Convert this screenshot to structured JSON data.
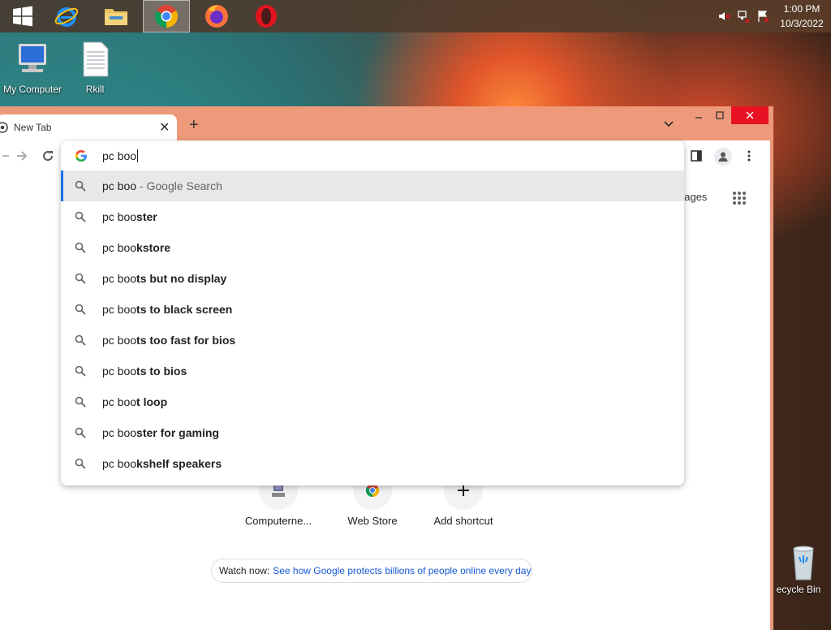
{
  "taskbar": {
    "apps": [
      {
        "name": "windows-start",
        "label": "Start"
      },
      {
        "name": "internet-explorer",
        "label": "Internet Explorer"
      },
      {
        "name": "file-explorer",
        "label": "File Explorer"
      },
      {
        "name": "chrome",
        "label": "Google Chrome"
      },
      {
        "name": "firefox",
        "label": "Firefox"
      },
      {
        "name": "opera",
        "label": "Opera"
      }
    ],
    "clock": {
      "time": "1:00 PM",
      "date": "10/3/2022"
    }
  },
  "desktop": {
    "icons": [
      {
        "label": "My Computer"
      },
      {
        "label": "Rkill"
      },
      {
        "label": "ecycle Bin"
      }
    ]
  },
  "browser": {
    "tab": {
      "title": "New Tab"
    },
    "new_tab": "+",
    "omnibox": {
      "value": "pc boo",
      "suggestions": [
        {
          "prefix": "pc boo",
          "rest": "",
          "suffix": " - Google Search"
        },
        {
          "prefix": "pc boo",
          "rest": "ster",
          "suffix": ""
        },
        {
          "prefix": "pc boo",
          "rest": "kstore",
          "suffix": ""
        },
        {
          "prefix": "pc boo",
          "rest": "ts but no display",
          "suffix": ""
        },
        {
          "prefix": "pc boo",
          "rest": "ts to black screen",
          "suffix": ""
        },
        {
          "prefix": "pc boo",
          "rest": "ts too fast for bios",
          "suffix": ""
        },
        {
          "prefix": "pc boo",
          "rest": "ts to bios",
          "suffix": ""
        },
        {
          "prefix": "pc boo",
          "rest": "t loop",
          "suffix": ""
        },
        {
          "prefix": "pc boo",
          "rest": "ster for gaming",
          "suffix": ""
        },
        {
          "prefix": "pc boo",
          "rest": "kshelf speakers",
          "suffix": ""
        }
      ]
    },
    "page": {
      "images_link": "nages",
      "shortcuts": [
        {
          "label": "Computerne..."
        },
        {
          "label": "Web Store"
        },
        {
          "label": "Add shortcut"
        }
      ],
      "watch": {
        "prefix": "Watch now:",
        "link": "See how Google protects billions of people online every day"
      }
    }
  },
  "colors": {
    "accent": "#1a73e8",
    "window_frame": "#ee9a7a",
    "close": "#e81123"
  }
}
